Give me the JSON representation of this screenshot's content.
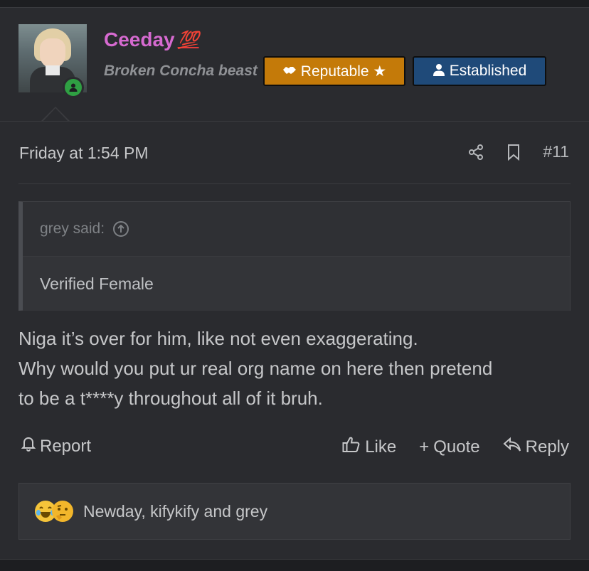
{
  "user": {
    "name": "Ceeday",
    "name_suffix": "💯",
    "title": "Broken Concha beast",
    "badges": [
      {
        "label": "Reputable ★",
        "icon": "handshake-icon",
        "color": "#c47a09"
      },
      {
        "label": "Established",
        "icon": "user-icon",
        "color": "#1f4a79"
      }
    ],
    "status": "online"
  },
  "post": {
    "date": "Friday at 1:54 PM",
    "number": "#11"
  },
  "quote": {
    "author": "grey said:",
    "body": "Verified Female"
  },
  "message": {
    "lines": [
      "Niga it’s over for him, like not even exaggerating.",
      "Why would you put ur real org name on here then pretend",
      "to be a t****y throughout all of it bruh."
    ]
  },
  "actions": {
    "report": "Report",
    "like": "Like",
    "quote": "Quote",
    "reply": "Reply"
  },
  "reactions": {
    "text": "Newday, kifykify and grey"
  },
  "colors": {
    "username": "#d66ad0",
    "background": "#2a2b2f",
    "online": "#2fa043"
  }
}
